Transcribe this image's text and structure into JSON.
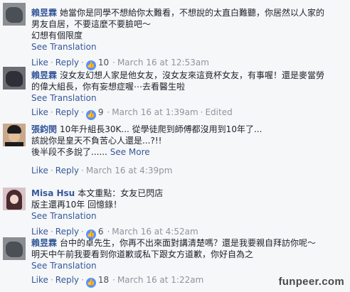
{
  "comments": [
    {
      "name": "賴昱霖",
      "lines": [
        "她當你是同學不想給你太難看，不想說的太直白難聽，你居然以人家的",
        "男友自居，不要這麼不要臉吧～",
        "幻想有個限度"
      ],
      "see_translation": "See Translation",
      "like_label": "Like",
      "reply_label": "Reply",
      "likes": "10",
      "time": "March 16 at 12:53am",
      "edited": ""
    },
    {
      "name": "賴昱霖",
      "lines": [
        "沒女友幻想人家是他女友，沒女友來這竟杯女友，有事喔！還是麥當勞",
        "的偉大組長，你有妄想症喔⋯去看醫生啦"
      ],
      "see_translation": "See Translation",
      "like_label": "Like",
      "reply_label": "Reply",
      "likes": "9",
      "time": "March 16 at 1:39am",
      "edited": "Edited"
    },
    {
      "name": "張鈞閔",
      "lines": [
        "10年升組長30K... 從學徒爬到師傅都沒用到10年了...",
        "該說你是皇天不負苦心人還是...?!!",
        "後半段不多說了......"
      ],
      "see_more": "See More",
      "like_label": "Like",
      "reply_label": "Reply",
      "likes": "",
      "time": "March 16 at 4:39pm",
      "edited": ""
    },
    {
      "name": "Misa Hsu",
      "lines": [
        "本文重點：女友已閃店",
        "版主還再10年 回憶錄！"
      ],
      "see_translation": "See Translation",
      "like_label": "Like",
      "reply_label": "Reply",
      "likes": "6",
      "time": "March 16 at 4:52am",
      "edited": ""
    },
    {
      "name": "賴昱霖",
      "lines": [
        "台中的卓先生，你再不出來面對講清楚嗎？還是我要親自拜訪你呢～",
        "明天中午前我要看到你道歉或私下跟女方道歉，你好自為之"
      ],
      "see_translation": "See Translation",
      "like_label": "Like",
      "reply_label": "Reply",
      "likes": "18",
      "time": "March 16 at 1:22am",
      "edited": ""
    }
  ],
  "watermark": "funpeer.com",
  "colors": {
    "link": "#365899",
    "meta": "#90949c",
    "like_badge": "#5890ff",
    "background": "#f6f7f9"
  }
}
